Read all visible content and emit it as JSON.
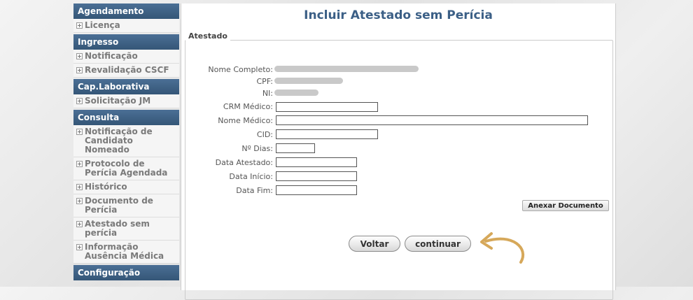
{
  "sidebar": {
    "sections": [
      {
        "header": "Agendamento",
        "items": [
          "Licença"
        ]
      },
      {
        "header": "Ingresso",
        "items": [
          "Notificação",
          "Revalidação CSCF"
        ]
      },
      {
        "header": "Cap.Laborativa",
        "items": [
          "Solicitação JM"
        ]
      },
      {
        "header": "Consulta",
        "items": [
          "Notificação de Candidato Nomeado",
          "Protocolo de Perícia Agendada",
          "Histórico",
          "Documento de Perícia",
          "Atestado sem perícia",
          "Informação Ausência Médica"
        ]
      },
      {
        "header": "Configuração",
        "items": []
      }
    ]
  },
  "main": {
    "title": "Incluir Atestado sem Perícia",
    "legend": "Atestado",
    "labels": {
      "nome_completo": "Nome Completo:",
      "cpf": "CPF:",
      "ni": "NI:",
      "crm": "CRM Médico:",
      "nome_medico": "Nome Médico:",
      "cid": "CID:",
      "dias": "Nº Dias:",
      "data_atestado": "Data Atestado:",
      "data_inicio": "Data Início:",
      "data_fim": "Data Fim:"
    },
    "values": {
      "crm": "",
      "nome_medico": "",
      "cid": "",
      "dias": "",
      "data_atestado": "",
      "data_inicio": "",
      "data_fim": ""
    },
    "attach_label": "Anexar Documento",
    "back_label": "Voltar",
    "continue_label": "continuar"
  },
  "colors": {
    "header": "#3f6288",
    "title": "#3b5f86",
    "arrow": "#d6a85a"
  }
}
